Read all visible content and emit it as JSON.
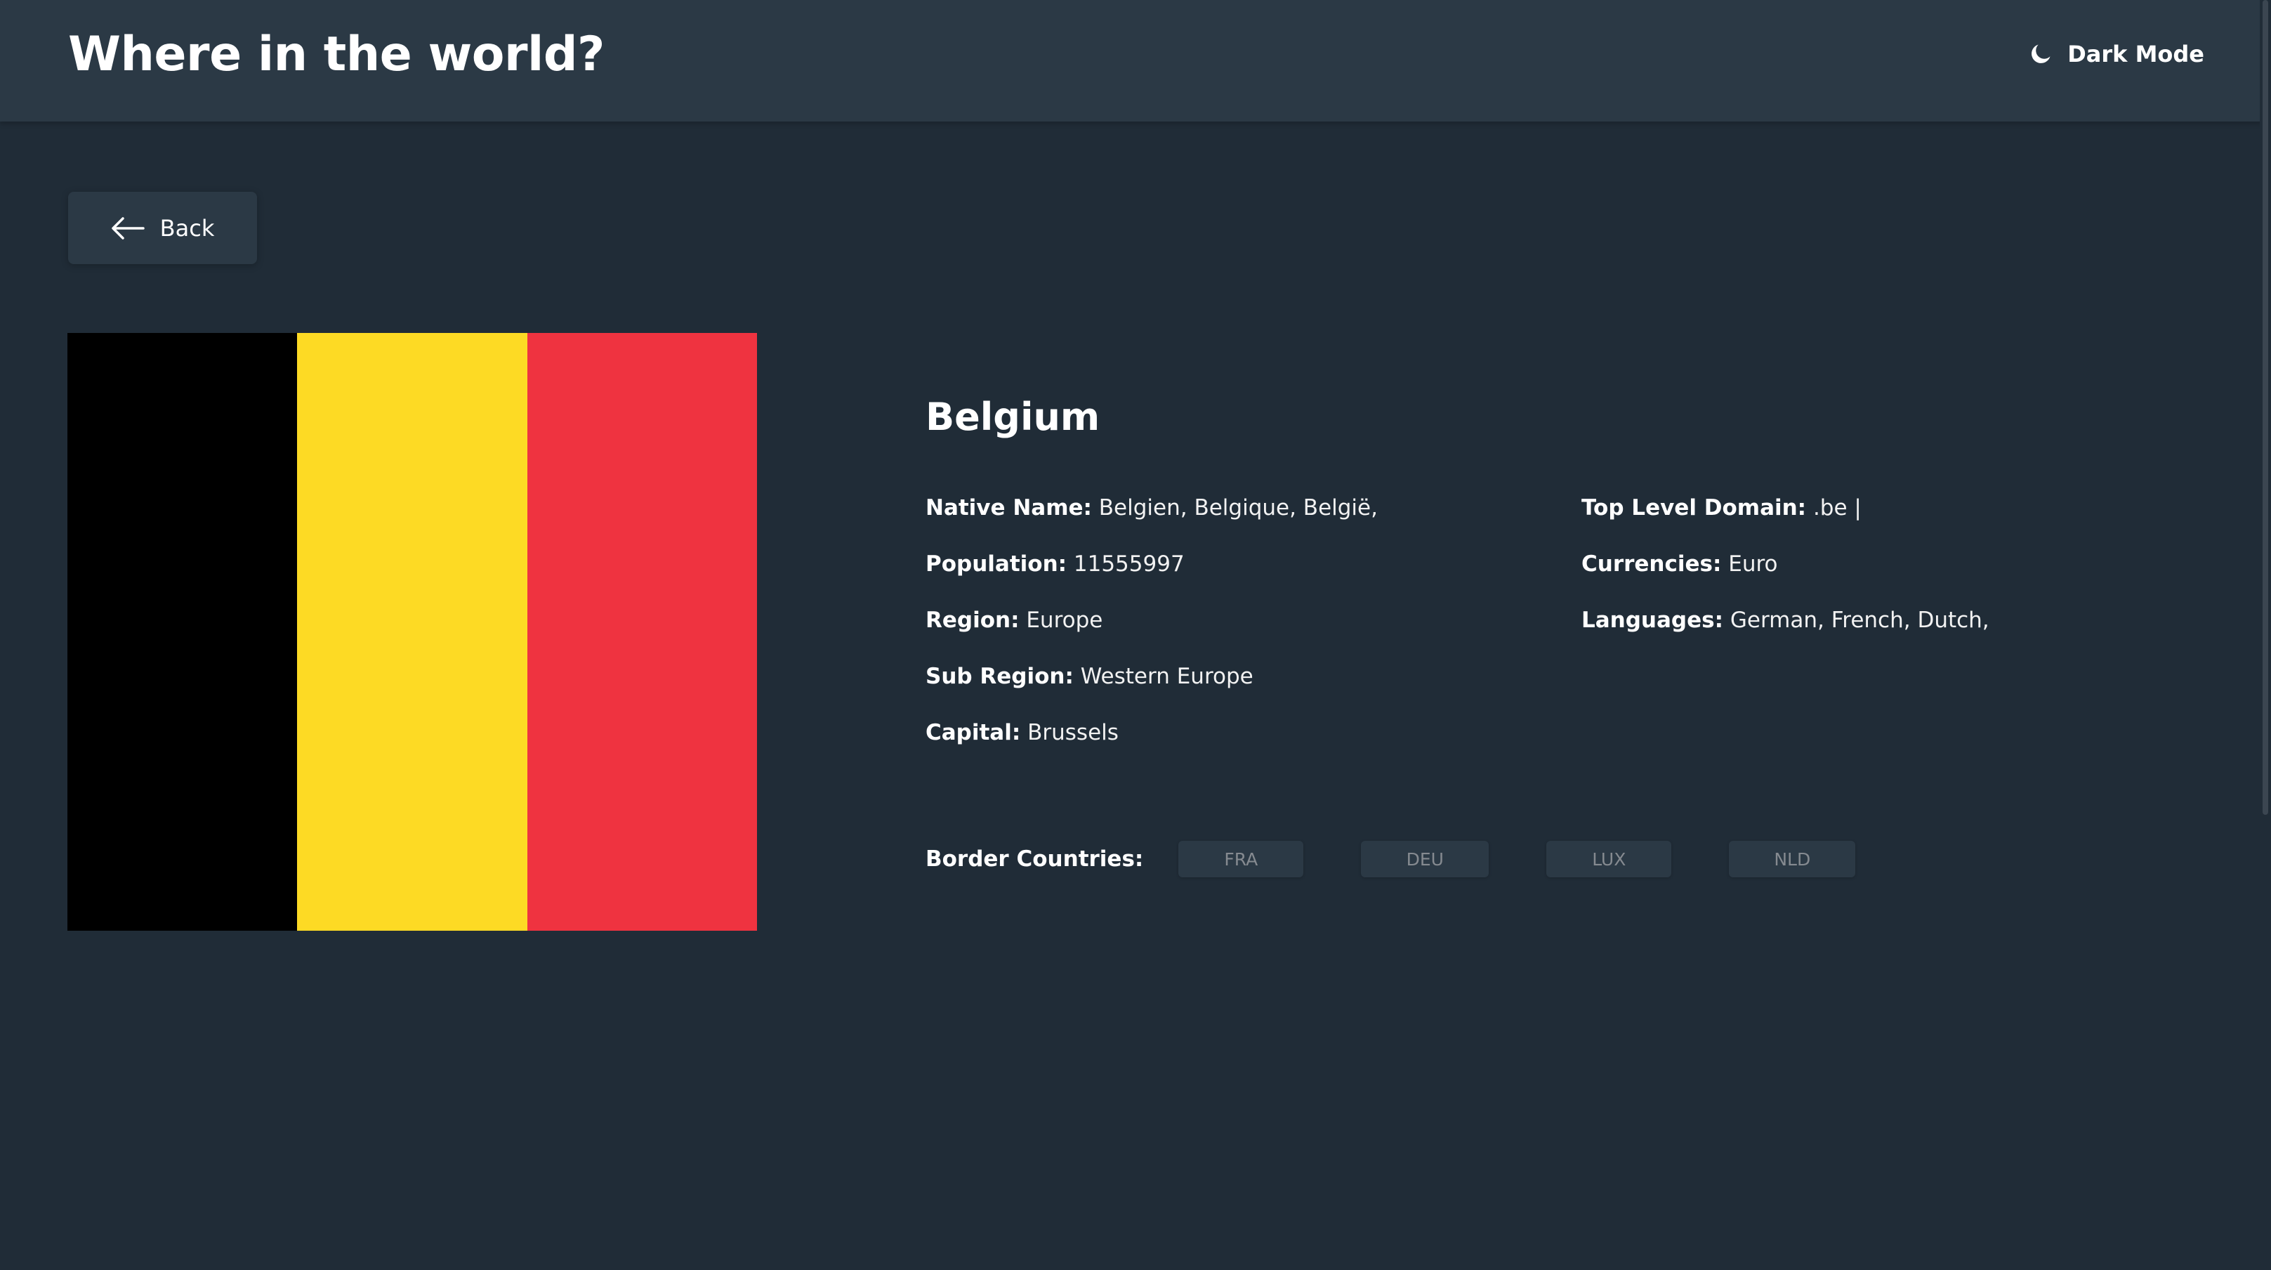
{
  "header": {
    "title": "Where in the world?",
    "mode_label": "Dark Mode",
    "mode_icon": "moon-icon"
  },
  "back": {
    "label": "Back",
    "icon": "arrow-left-icon"
  },
  "country": {
    "name": "Belgium",
    "flag": {
      "colors": [
        "#000000",
        "#fdda24",
        "#ef3340"
      ]
    },
    "details_left": [
      {
        "key": "Native Name:",
        "value": "Belgien, Belgique, België,"
      },
      {
        "key": "Population:",
        "value": "11555997"
      },
      {
        "key": "Region:",
        "value": "Europe"
      },
      {
        "key": "Sub Region:",
        "value": "Western Europe"
      },
      {
        "key": "Capital:",
        "value": "Brussels"
      }
    ],
    "details_right": [
      {
        "key": "Top Level Domain:",
        "value": ".be |"
      },
      {
        "key": "Currencies:",
        "value": "Euro"
      },
      {
        "key": "Languages:",
        "value": "German, French, Dutch,"
      }
    ],
    "border_label": "Border Countries:",
    "borders": [
      "FRA",
      "DEU",
      "LUX",
      "NLD"
    ]
  },
  "colors": {
    "background": "#202c37",
    "elements": "#2b3945",
    "text": "#ffffff",
    "chip_text": "#858a90"
  }
}
